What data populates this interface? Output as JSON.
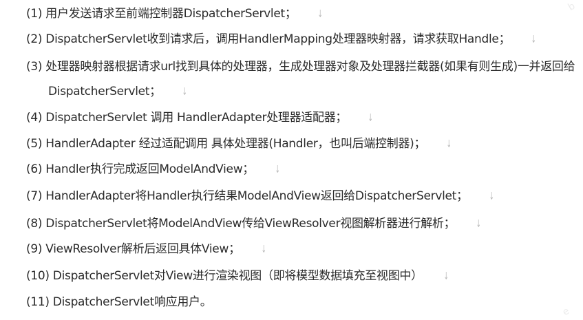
{
  "steps": [
    {
      "text": "(1)  用户发送请求至前端控制器DispatcherServlet；",
      "arrow": "↓"
    },
    {
      "text": "(2)   DispatcherServlet收到请求后，调用HandlerMapping处理器映射器，请求获取Handle；",
      "arrow": "↓"
    },
    {
      "text": "(3)  处理器映射器根据请求url找到具体的处理器，生成处理器对象及处理器拦截器(如果有则生成)一并返回给",
      "arrow": ""
    },
    {
      "text": "DispatcherServlet；",
      "arrow": "↓"
    },
    {
      "text": "(4)  DispatcherServlet 调用 HandlerAdapter处理器适配器；",
      "arrow": "↓"
    },
    {
      "text": "(5)  HandlerAdapter 经过适配调用 具体处理器(Handler，也叫后端控制器)；",
      "arrow": "↓"
    },
    {
      "text": "(6)  Handler执行完成返回ModelAndView；",
      "arrow": "↓"
    },
    {
      "text": "(7)  HandlerAdapter将Handler执行结果ModelAndView返回给DispatcherServlet；",
      "arrow": "↓"
    },
    {
      "text": "(8)  DispatcherServlet将ModelAndView传给ViewResolver视图解析器进行解析；",
      "arrow": "↓"
    },
    {
      "text": "(9)  ViewResolver解析后返回具体View；",
      "arrow": "↓"
    },
    {
      "text": "(10)  DispatcherServlet对View进行渲染视图（即将模型数据填充至视图中）",
      "arrow": "↓"
    },
    {
      "text": "(11)  DispatcherServlet响应用户。",
      "arrow": ""
    }
  ],
  "watermarks": [
    "b",
    "e"
  ]
}
